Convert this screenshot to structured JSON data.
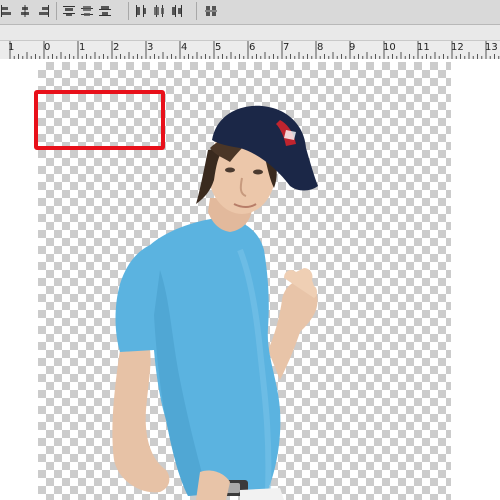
{
  "toolbar": {
    "groups": [
      {
        "icons": [
          "align-left-icon",
          "align-center-icon",
          "align-right-icon"
        ]
      },
      {
        "icons": [
          "distribute-top-icon",
          "distribute-middle-icon",
          "distribute-bottom-icon"
        ]
      },
      {
        "icons": [
          "distribute-left-icon",
          "distribute-hcenter-icon",
          "distribute-right-icon"
        ]
      },
      {
        "icons": [
          "auto-align-icon"
        ]
      }
    ]
  },
  "ruler": {
    "labels": [
      "1",
      "0",
      "1",
      "2",
      "3",
      "4",
      "5",
      "6",
      "7",
      "8",
      "9",
      "10",
      "11",
      "12",
      "13",
      "1"
    ]
  },
  "colors": {
    "highlight": "#e8101a",
    "shirt": "#5bb3e0",
    "cap": "#1b2747"
  }
}
